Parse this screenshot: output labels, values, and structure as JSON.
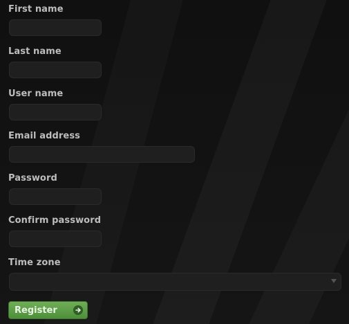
{
  "form": {
    "fields": [
      {
        "label": "First name",
        "value": ""
      },
      {
        "label": "Last name",
        "value": ""
      },
      {
        "label": "User name",
        "value": ""
      },
      {
        "label": "Email address",
        "value": ""
      },
      {
        "label": "Password",
        "value": ""
      },
      {
        "label": "Confirm password",
        "value": ""
      },
      {
        "label": "Time zone",
        "value": ""
      }
    ],
    "submit_label": "Register"
  },
  "colors": {
    "background": "#121212",
    "input_background": "#1f1f1f",
    "label_text": "#bdbdbd",
    "button_green": "#5d9f45"
  },
  "icons": {
    "register_button_icon": "arrow-right-circle-icon",
    "select_icon": "chevron-down-icon"
  }
}
